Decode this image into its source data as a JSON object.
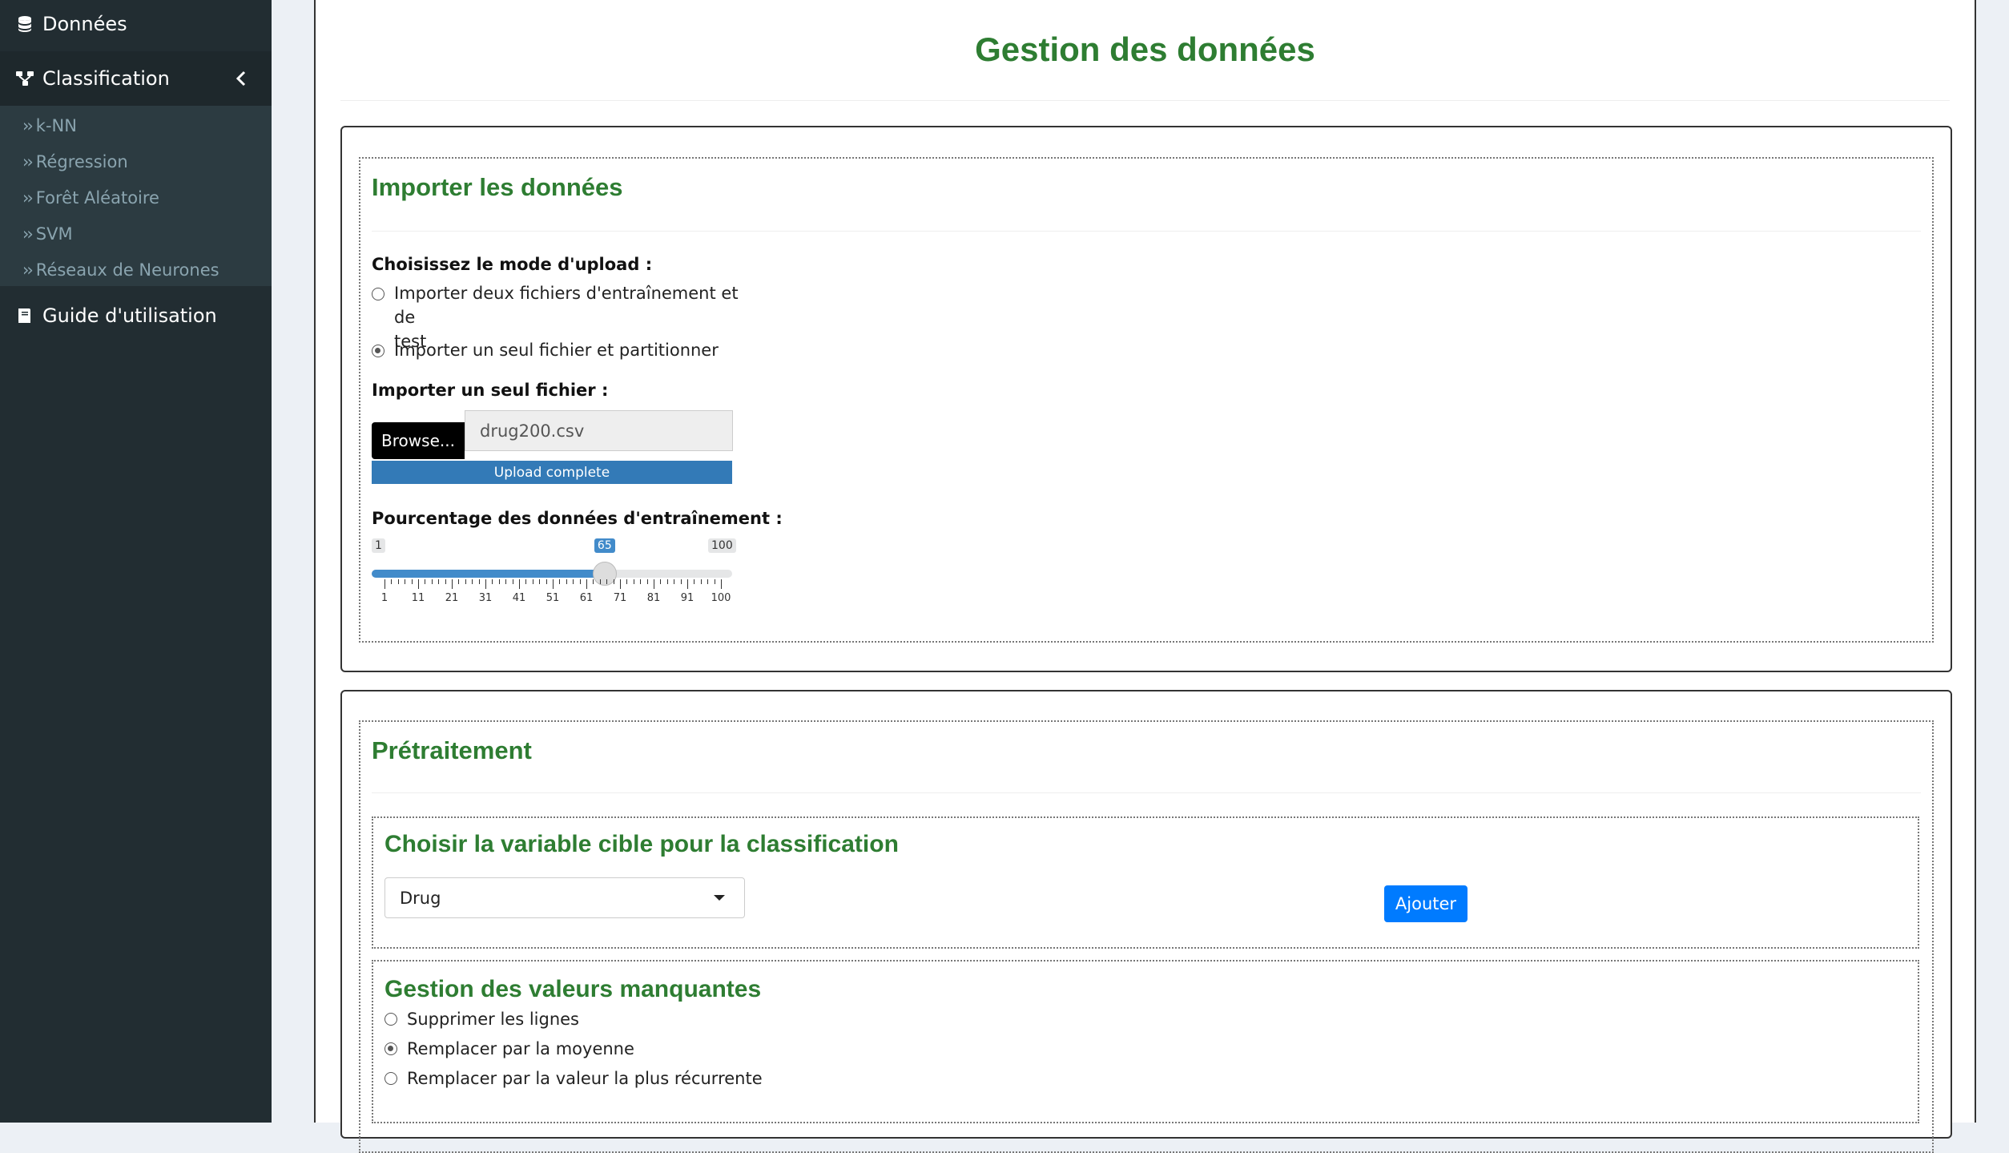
{
  "sidebar": {
    "items": [
      {
        "label": "Données",
        "icon": "database-icon"
      },
      {
        "label": "Classification",
        "icon": "sitemap-icon"
      },
      {
        "label": "Guide d'utilisation",
        "icon": "book-icon"
      }
    ],
    "sub_items": [
      {
        "label": "k-NN"
      },
      {
        "label": "Régression"
      },
      {
        "label": "Forêt Aléatoire"
      },
      {
        "label": "SVM"
      },
      {
        "label": "Réseaux de Neurones"
      }
    ]
  },
  "main": {
    "title": "Gestion des données",
    "import": {
      "title": "Importer les données",
      "mode_label": "Choisissez le mode d'upload :",
      "mode_options": [
        {
          "line1": "Importer deux fichiers d'entraînement et de",
          "line2": "test",
          "checked": false
        },
        {
          "line1": "Importer un seul fichier et partitionner",
          "checked": true
        }
      ],
      "file_label": "Importer un seul fichier :",
      "browse_label": "Browse...",
      "file_name": "drug200.csv",
      "progress_text": "Upload complete",
      "progress_fraction": 1.0,
      "slider_label": "Pourcentage des données d'entraînement :",
      "slider_min": 1,
      "slider_max": 100,
      "slider_value": 65,
      "slider_min_text": "1",
      "slider_max_text": "100",
      "slider_value_text": "65",
      "ticks": [
        "1",
        "11",
        "21",
        "31",
        "41",
        "51",
        "61",
        "71",
        "81",
        "91",
        "100"
      ]
    },
    "preprocess": {
      "title": "Prétraitement",
      "target": {
        "title": "Choisir la variable cible pour la classification",
        "selected": "Drug",
        "add_button": "Ajouter"
      },
      "missing": {
        "title": "Gestion des valeurs manquantes",
        "options": [
          {
            "label": "Supprimer les lignes",
            "checked": false
          },
          {
            "label": "Remplacer par la moyenne",
            "checked": true
          },
          {
            "label": "Remplacer par la valeur la plus récurrente",
            "checked": false
          }
        ]
      }
    }
  },
  "colors": {
    "sidebar_bg": "#222d32",
    "title_green": "#2e7d32",
    "accent_blue": "#428bca",
    "button_blue": "#007bff"
  }
}
